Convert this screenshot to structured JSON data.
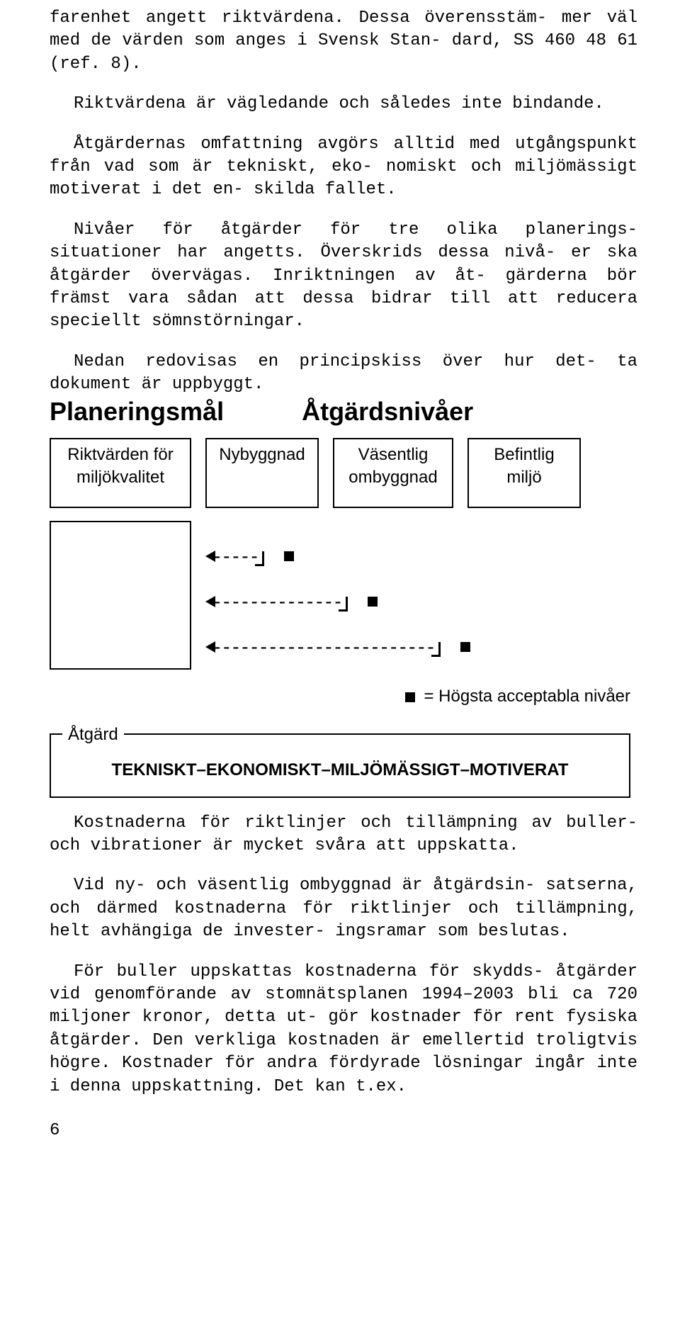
{
  "p1": "farenhet angett riktvärdena. Dessa överensstäm- mer väl med de värden som anges i Svensk Stan- dard, SS 460 48 61 (ref. 8).",
  "p2": "Riktvärdena är vägledande och således inte bindande.",
  "p3": "Åtgärdernas omfattning avgörs alltid med utgångspunkt från vad som är tekniskt, eko- nomiskt och miljömässigt motiverat i det en- skilda fallet.",
  "p4": "Nivåer för åtgärder för tre olika planerings- situationer har angetts. Överskrids dessa nivå- er ska åtgärder övervägas. Inriktningen av åt- gärderna bör främst vara sådan att dessa bidrar till att reducera speciellt sömnstörningar.",
  "p5": "Nedan redovisas en principskiss över hur det- ta dokument är uppbyggt.",
  "diagram": {
    "heading_left": "Planeringsmål",
    "heading_right": "Åtgärdsnivåer",
    "box1_line1": "Riktvärden för",
    "box1_line2": "miljökvalitet",
    "box2": "Nybyggnad",
    "box3_line1": "Väsentlig",
    "box3_line2": "ombyggnad",
    "box4_line1": "Befintlig",
    "box4_line2": "miljö",
    "legend": "= Högsta acceptabla nivåer",
    "action_tab": "Åtgärd",
    "action_text": "TEKNISKT–EKONOMISKT–MILJÖMÄSSIGT–MOTIVERAT"
  },
  "p6": "Kostnaderna för riktlinjer och tillämpning av buller- och vibrationer är mycket svåra att uppskatta.",
  "p7": "Vid ny- och väsentlig ombyggnad är åtgärdsin- satserna, och därmed kostnaderna för riktlinjer och tillämpning, helt avhängiga de invester- ingsramar som beslutas.",
  "p8": "För buller uppskattas kostnaderna för skydds- åtgärder vid genomförande av stomnätsplanen 1994–2003 bli ca 720 miljoner kronor, detta ut- gör kostnader för rent fysiska åtgärder. Den verkliga kostnaden är emellertid troligtvis högre. Kostnader för andra fördyrade lösningar ingår inte i denna uppskattning. Det kan t.ex.",
  "page_number": "6"
}
